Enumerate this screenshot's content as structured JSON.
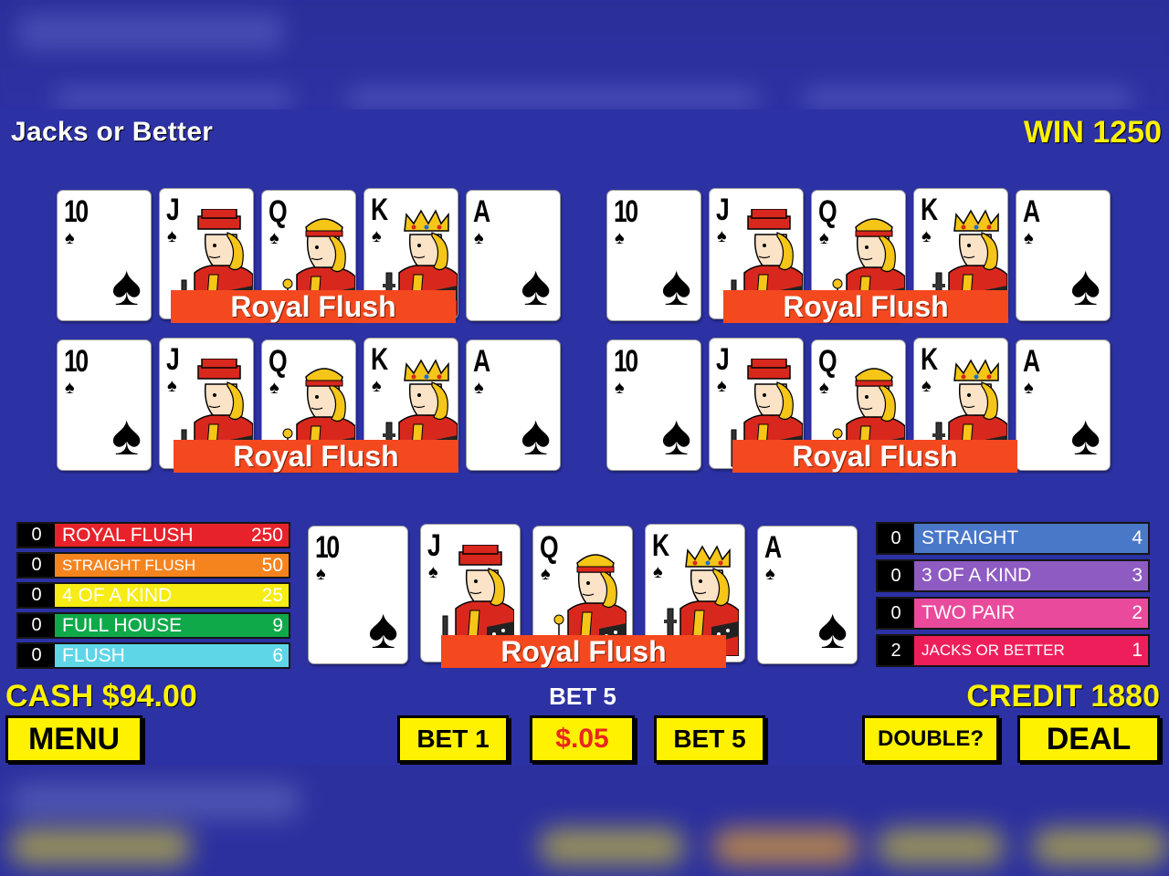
{
  "game": {
    "title": "Jacks or Better",
    "win_text": "WIN 1250",
    "cash_text": "CASH $94.00",
    "credit_text": "CREDIT 1880",
    "bet_label": "BET 5"
  },
  "hands": [
    {
      "banner": "Royal Flush"
    },
    {
      "banner": "Royal Flush"
    },
    {
      "banner": "Royal Flush"
    },
    {
      "banner": "Royal Flush"
    },
    {
      "banner": "Royal Flush"
    }
  ],
  "cards": [
    {
      "rank": "10",
      "suit": "♠"
    },
    {
      "rank": "J",
      "suit": "♠"
    },
    {
      "rank": "Q",
      "suit": "♠"
    },
    {
      "rank": "K",
      "suit": "♠"
    },
    {
      "rank": "A",
      "suit": "♠"
    }
  ],
  "paytable_left": [
    {
      "count": "0",
      "name": "ROYAL FLUSH",
      "value": "250",
      "color": "#e8222b"
    },
    {
      "count": "0",
      "name": "STRAIGHT FLUSH",
      "value": "50",
      "color": "#f5841f"
    },
    {
      "count": "0",
      "name": "4 OF A KIND",
      "value": "25",
      "color": "#f7ec13"
    },
    {
      "count": "0",
      "name": "FULL HOUSE",
      "value": "9",
      "color": "#10a94a"
    },
    {
      "count": "0",
      "name": "FLUSH",
      "value": "6",
      "color": "#5fd6e8"
    }
  ],
  "paytable_right": [
    {
      "count": "0",
      "name": "STRAIGHT",
      "value": "4",
      "color": "#4a78c9"
    },
    {
      "count": "0",
      "name": "3 OF A KIND",
      "value": "3",
      "color": "#8d5bc1"
    },
    {
      "count": "0",
      "name": "TWO PAIR",
      "value": "2",
      "color": "#e94a9b"
    },
    {
      "count": "2",
      "name": "JACKS OR BETTER",
      "value": "1",
      "color": "#ee1e5b"
    }
  ],
  "buttons": {
    "menu": "MENU",
    "bet1": "BET 1",
    "denom": "$.05",
    "bet5": "BET 5",
    "double": "DOUBLE?",
    "deal": "DEAL"
  },
  "colors": {
    "background": "#2c31a4",
    "accent_yellow": "#fff200",
    "banner_red": "#f4481f"
  }
}
